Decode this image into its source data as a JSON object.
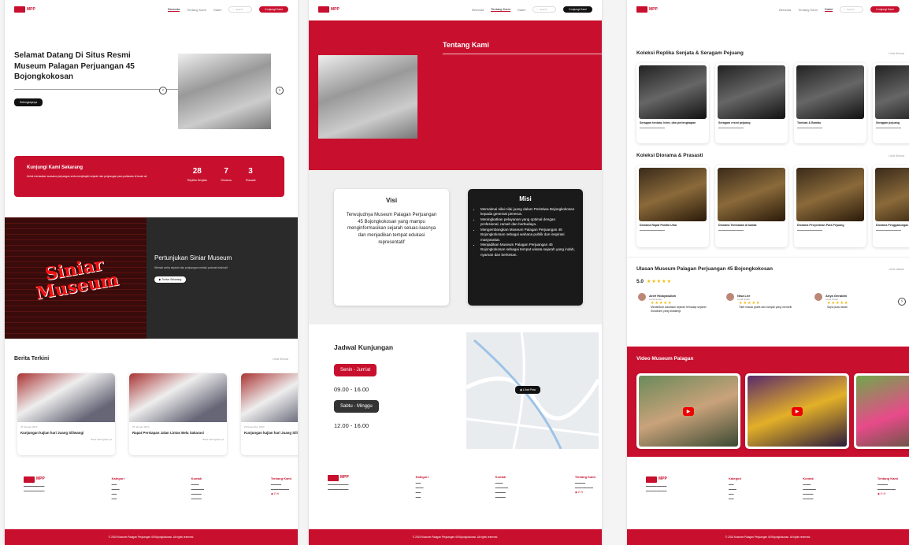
{
  "brand": {
    "primary": "#c8102e",
    "dark": "#1a1a1a"
  },
  "nav": {
    "beranda": "Beranda",
    "tentang": "Tentang Kami",
    "galeri": "Galeri",
    "search": "Search",
    "cta": "Kunjungi Kami"
  },
  "p1": {
    "hero_title": "Selamat Datang Di Situs Resmi Museum Palagan Perjuangan 45 Bojongkokosan",
    "hero_button": "Selengkapnya",
    "visit_title": "Kunjungi Kami Sekarang",
    "visit_desc": "Untuk merasakan suasana perjuangan serta menjelajahi sejarah dan perjuangan para pahlawan di tanah air",
    "stats": [
      {
        "n": "28",
        "l": "Replika Senjata"
      },
      {
        "n": "7",
        "l": "Diorama"
      },
      {
        "n": "3",
        "l": "Prasasti"
      }
    ],
    "podcast_badge": "Siniar Museum",
    "podcast_title": "Pertunjukan Siniar Museum",
    "podcast_desc": "Nikmati cerita sejarah dan perjuangan melalui podcast eksklusif",
    "podcast_button": "Tonton Sekarang",
    "news_title": "Berita Terkini",
    "news_more": "Lihat Semua",
    "news": [
      {
        "date": "25 Januari 2024",
        "title": "Kunjungan kajian hari Juang Siliwangi",
        "more": "Baca Selengkapnya"
      },
      {
        "date": "25 Januari 2024",
        "title": "Rapat Persiapan Jalan Lintas Bela Sakarasi",
        "more": "Baca Selengkapnya"
      },
      {
        "date": "25 Desember 2023",
        "title": "Kunjungan kajian hari Juang Siliwangi",
        "more": ""
      }
    ]
  },
  "p2": {
    "about_title": "Tentang Kami",
    "visi_title": "Visi",
    "visi_text": "Terwujudnya Museum Palagan Perjuangan 45 Bojongkokosan yang mampu menginformasikan sejarah seluas-luasnya dan menjadikan tempat edukasi representatif",
    "misi_title": "Misi",
    "misi": [
      "Memaknai nilai-nilai juang dalam Peristiwa Bojongkokosan kepada generasi penerus.",
      "Meningkatkan pelayanan yang optimal dengan profesional, ramah dan berbudaya.",
      "Mengembangkan Museum Palagan Perjuangan 45 Bojongkokosan sebagai wahana publik dan inspirasi masyarakat.",
      "Menjadikan Museum Palagan Perjuangan 45 Bojongkokosan sebagai tempat wisata sejarah yang indah, nyaman dan berkesan."
    ],
    "schedule_title": "Jadwal Kunjungan",
    "weekday": "Senin - Jum'at",
    "weekday_hours": "09.00 - 16.00",
    "weekend": "Sabtu - Minggu",
    "weekend_hours": "12.00 - 16.00",
    "map_button": "Lihat Peta"
  },
  "p3": {
    "weapons_title": "Koleksi Replika Senjata & Seragam Pejuang",
    "more": "Lihat Semua",
    "weapons": [
      "Seragam tentara, helm, dan perlengkapan",
      "Seragam resmi pejuang",
      "Tombak & Bambu",
      "Seragam pejuang"
    ],
    "diorama_title": "Koleksi Diorama & Prasasti",
    "dioramas": [
      "Diorama Rapat Panitia Uma",
      "Diorama Tembakan di badak",
      "Diorama Penyerahan Para Pejuang",
      "Diorama Penggabungan"
    ],
    "reviews_title": "Ulasan Museum Palagan Perjuangan 45 Bojongkokosan",
    "reviews_more": "Lihat Ulasan",
    "rating": "5.0",
    "reviews": [
      {
        "name": "Arief Hidayatullah",
        "role": "Local Guide",
        "text": "Menambah wawasan sejarah terhadap sejarah Sukabumi yang didatangi"
      },
      {
        "name": "Nisa Lee",
        "role": "Local Guide",
        "text": "Tiket masuk gratis dan banyak yang menarik"
      },
      {
        "name": "Anya Geraldin",
        "role": "Local Guide",
        "text": "Saya puas sekali"
      }
    ],
    "video_title": "Video Museum Palagan"
  },
  "footer": {
    "col1": "Kategori",
    "col2": "Kontak",
    "col3": "Tentang Kami",
    "copyright": "© 2024 Museum Palagan Perjuangan 45 Bojongkokosan. All rights reserved."
  }
}
